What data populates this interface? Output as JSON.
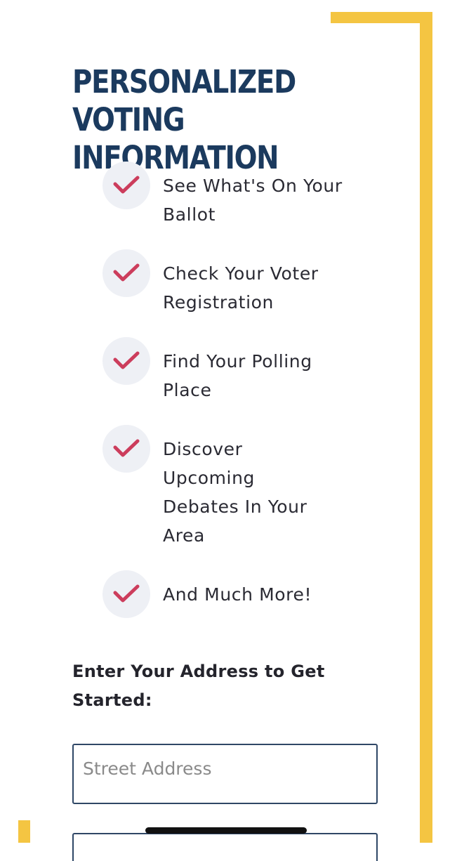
{
  "title": "PERSONALIZED VOTING INFORMATION",
  "accent_color": "#f4c542",
  "check_color": "#cc3d5c",
  "benefits": [
    {
      "icon": "checkmark-icon",
      "label": "See What's On Your Ballot"
    },
    {
      "icon": "checkmark-icon",
      "label": "Check Your Voter Registration"
    },
    {
      "icon": "checkmark-icon",
      "label": "Find Your Polling Place"
    },
    {
      "icon": "checkmark-icon",
      "label": "Discover Upcoming Debates In Your Area"
    },
    {
      "icon": "checkmark-icon",
      "label": "And Much More!"
    }
  ],
  "address_form": {
    "prompt": "Enter Your Address to Get Started:",
    "street_placeholder": "Street Address",
    "street_value": ""
  }
}
